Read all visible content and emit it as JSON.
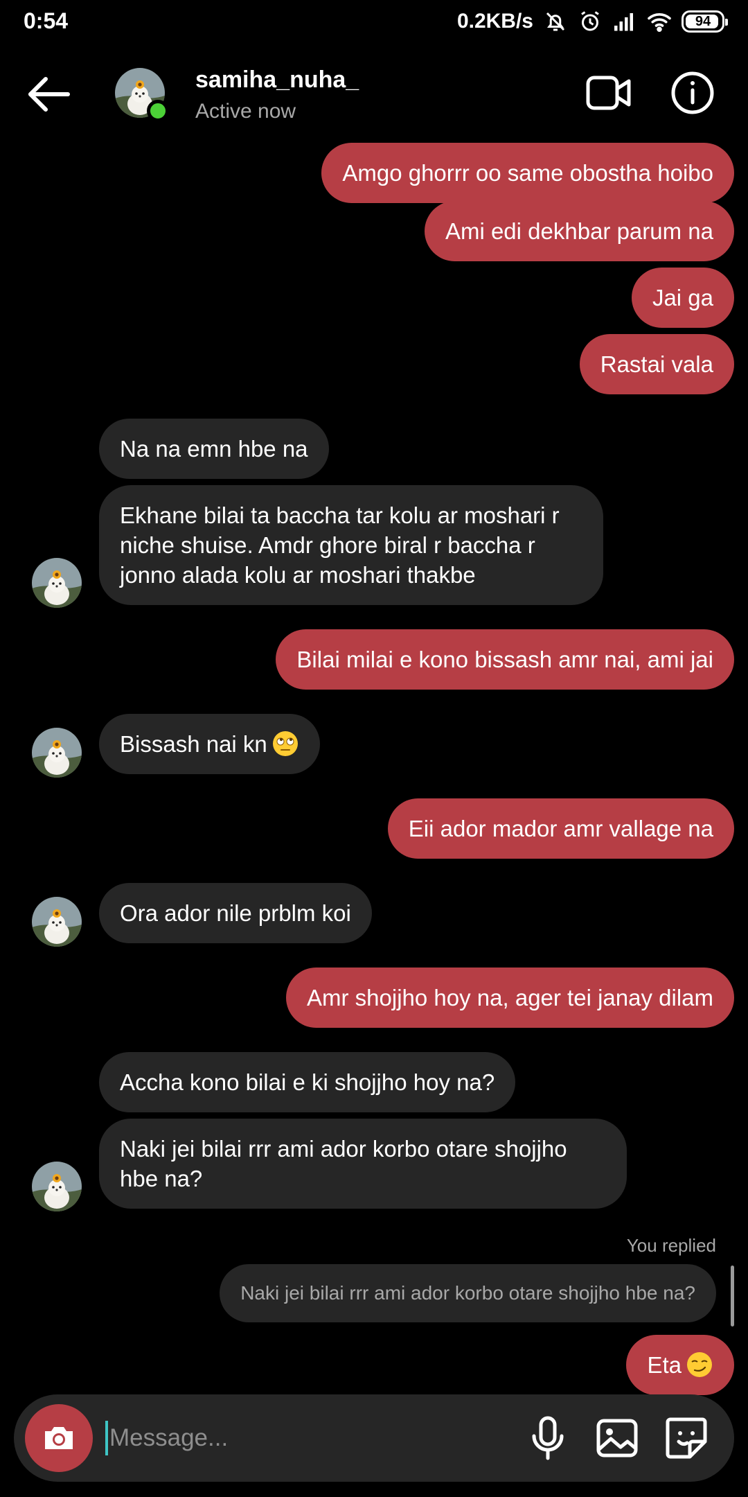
{
  "status_bar": {
    "time": "0:54",
    "net_speed": "0.2KB/s",
    "battery": "94",
    "battery_level": 0.94
  },
  "header": {
    "username": "samiha_nuha_",
    "status": "Active now",
    "online_color": "#4cd137"
  },
  "colors": {
    "sent_bubble": "#b63e45",
    "received_bubble": "#262626",
    "background": "#000000"
  },
  "messages": [
    {
      "from": "me",
      "text": "Amgo ghorrr oo same obostha hoibo"
    },
    {
      "from": "me",
      "text": "Ami edi dekhbar parum na"
    },
    {
      "from": "me",
      "text": "Jai ga"
    },
    {
      "from": "me",
      "text": "Rastai vala"
    },
    {
      "from": "them",
      "text": "Na na emn hbe na"
    },
    {
      "from": "them",
      "text": "Ekhane bilai ta baccha tar kolu ar moshari r niche shuise. Amdr ghore biral r baccha r jonno alada kolu ar moshari thakbe"
    },
    {
      "from": "me",
      "text": "Bilai milai e kono bissash amr nai, ami jai"
    },
    {
      "from": "them",
      "text": "Bissash nai kn",
      "emoji": "face-with-rolling-eyes-emoji"
    },
    {
      "from": "me",
      "text": "Eii ador mador amr vallage na"
    },
    {
      "from": "them",
      "text": "Ora ador nile prblm koi"
    },
    {
      "from": "me",
      "text": "Amr shojjho hoy na, ager tei janay dilam"
    },
    {
      "from": "them",
      "text": "Accha kono bilai e ki shojjho hoy na?"
    },
    {
      "from": "them",
      "text": "Naki jei bilai rrr ami ador korbo otare shojjho hbe na?"
    },
    {
      "from": "me",
      "text": "Eta",
      "emoji": "smirking-face-emoji"
    }
  ],
  "reply": {
    "label": "You replied",
    "quoted_text": "Naki jei bilai rrr ami ador korbo otare shojjho hbe na?"
  },
  "composer": {
    "placeholder": "Message..."
  }
}
